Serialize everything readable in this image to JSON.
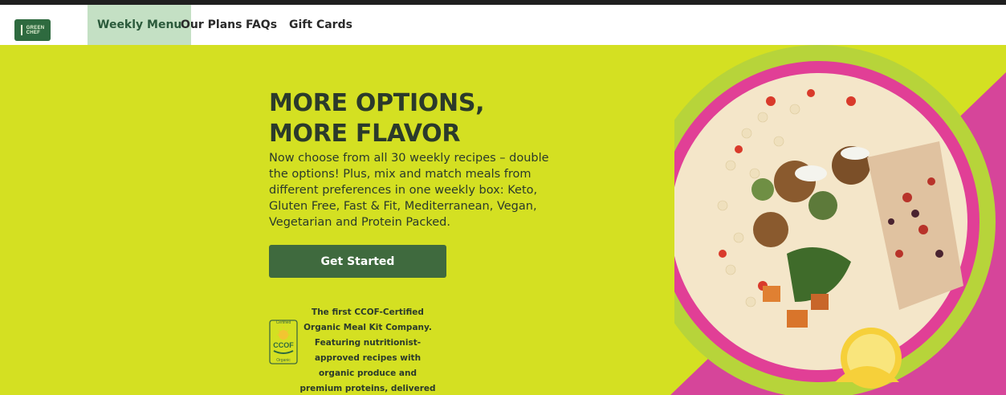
{
  "brand": {
    "logo_text_line1": "GREEN",
    "logo_text_line2": "CHEF",
    "logo_color": "#2e6a3f"
  },
  "nav": {
    "items": [
      {
        "label": "Weekly Menu",
        "active": true
      },
      {
        "label": "Our Plans",
        "active": false
      },
      {
        "label": "FAQs",
        "active": false
      },
      {
        "label": "Gift Cards",
        "active": false
      }
    ]
  },
  "hero": {
    "heading_line1": "MORE OPTIONS,",
    "heading_line2": "MORE FLAVOR",
    "body": "Now choose from all 30 weekly recipes – double the options! Plus, mix and match meals from different preferences in one weekly box: Keto, Gluten Free, Fast & Fit, Mediterranean, Vegan, Vegetarian and Protein Packed.",
    "cta_label": "Get Started",
    "badge_top": "Certified",
    "badge_name": "CCOF",
    "badge_bottom": "Organic",
    "badge_text": "The first CCOF-Certified Organic Meal Kit Company. Featuring nutritionist-approved recipes with organic produce and premium proteins, delivered to your door."
  },
  "colors": {
    "hero_bg": "#d4e022",
    "accent_pink": "#d6459a",
    "button": "#3f6a3e",
    "active_tab": "#c4e0c4"
  }
}
